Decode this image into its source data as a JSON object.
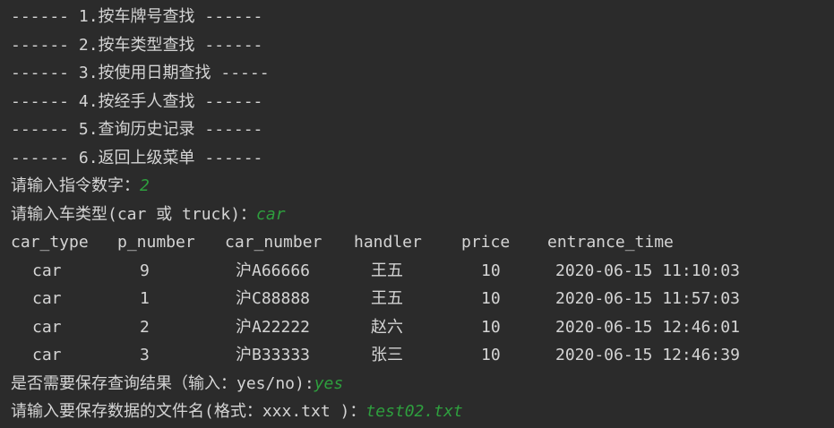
{
  "menu": [
    "------ 1.按车牌号查找 ------",
    "------ 2.按车类型查找 ------",
    "------ 3.按使用日期查找 -----",
    "------ 4.按经手人查找 ------",
    "------ 5.查询历史记录 ------",
    "------ 6.返回上级菜单 ------"
  ],
  "prompt_command": {
    "text": "请输入指令数字：",
    "input": "2"
  },
  "prompt_type": {
    "text": "请输入车类型(car 或 truck)：",
    "input": "car"
  },
  "table": {
    "headers": [
      "car_type",
      "p_number",
      "car_number",
      "handler",
      "price",
      "entrance_time"
    ],
    "rows": [
      [
        "car",
        "9",
        "沪A66666",
        "王五",
        "10",
        "2020-06-15 11:10:03"
      ],
      [
        "car",
        "1",
        "沪C88888",
        "王五",
        "10",
        "2020-06-15 11:57:03"
      ],
      [
        "car",
        "2",
        "沪A22222",
        "赵六",
        "10",
        "2020-06-15 12:46:01"
      ],
      [
        "car",
        "3",
        "沪B33333",
        "张三",
        "10",
        "2020-06-15 12:46:39"
      ]
    ]
  },
  "prompt_save": {
    "text": "是否需要保存查询结果（输入：yes/no):",
    "input": "yes"
  },
  "prompt_filename": {
    "text": "请输入要保存数据的文件名(格式：xxx.txt )：",
    "input": "test02.txt"
  },
  "colors": {
    "background": "#2b2b2b",
    "text": "#d4d4d4",
    "user_input": "#2e9f3e"
  }
}
